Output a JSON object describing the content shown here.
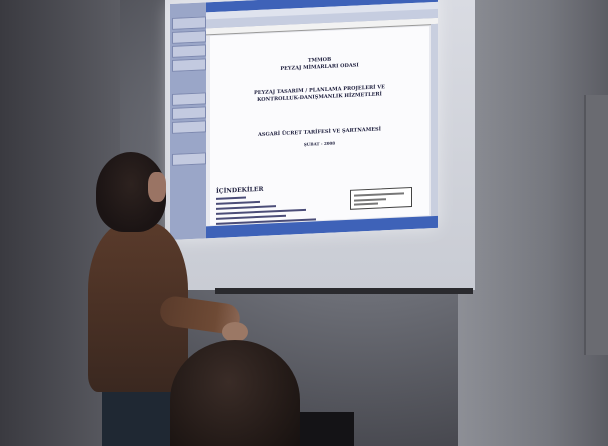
{
  "document": {
    "org_line1": "TMMOB",
    "org_line2": "PEYZAJ MİMARLARI ODASI",
    "heading1": "PEYZAJ TASARIM / PLANLAMA PROJELERİ VE",
    "heading2": "KONTROLLUK-DANIŞMANLIK HİZMETLERİ",
    "heading3": "ASGARİ ÜCRET TARİFESİ VE ŞARTNAMESİ",
    "date": "ŞUBAT - 2008",
    "toc_title": "İÇİNDEKİLER"
  },
  "colors": {
    "window_titlebar": "#3e62b8",
    "task_pane": "#9aa6c8",
    "page": "#fbfbfd",
    "text": "#1d1e3d"
  }
}
